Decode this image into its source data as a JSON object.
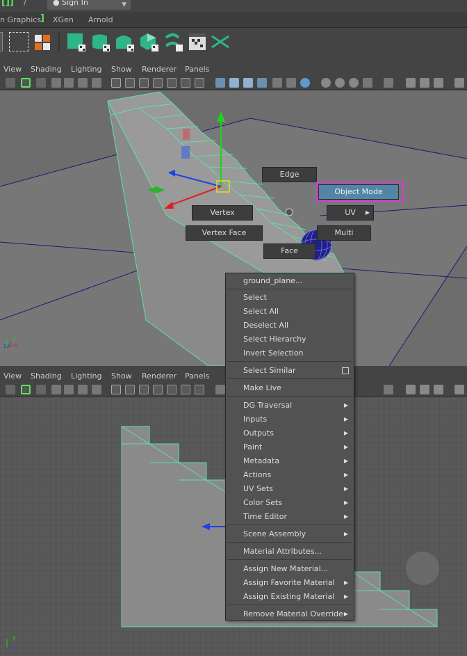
{
  "topbar": {
    "signin_label": "Sign In"
  },
  "shelf_tabs": [
    "n Graphics",
    "XGen",
    "Arnold"
  ],
  "panel_menu": [
    "View",
    "Shading",
    "Lighting",
    "Show",
    "Renderer",
    "Panels"
  ],
  "marking_menu": {
    "edge": "Edge",
    "object_mode": "Object Mode",
    "vertex": "Vertex",
    "uv": "UV",
    "vertex_face": "Vertex Face",
    "multi": "Multi",
    "face": "Face"
  },
  "context_menu": {
    "object_name": "ground_plane...",
    "items": {
      "select": "Select",
      "select_all": "Select All",
      "deselect_all": "Deselect All",
      "select_hierarchy": "Select Hierarchy",
      "invert_selection": "Invert Selection",
      "select_similar": "Select Similar",
      "make_live": "Make Live",
      "dg_traversal": "DG Traversal",
      "inputs": "Inputs",
      "outputs": "Outputs",
      "paint": "Paint",
      "metadata": "Metadata",
      "actions": "Actions",
      "uv_sets": "UV Sets",
      "color_sets": "Color Sets",
      "time_editor": "Time Editor",
      "scene_assembly": "Scene Assembly",
      "material_attributes": "Material Attributes...",
      "assign_new_material": "Assign New Material...",
      "assign_favorite_material": "Assign Favorite Material",
      "assign_existing_material": "Assign Existing Material",
      "remove_material_override": "Remove Material Override"
    }
  },
  "axis_labels": {
    "x": "x",
    "y": "y",
    "z": "z"
  },
  "colors": {
    "wire_selected": "#5fe0a8",
    "menu_bg": "#525252",
    "highlight": "#5285a6",
    "annotation": "#d63ad6",
    "x_axis": "#e02020",
    "y_axis": "#20d020",
    "z_axis": "#2040e0"
  }
}
